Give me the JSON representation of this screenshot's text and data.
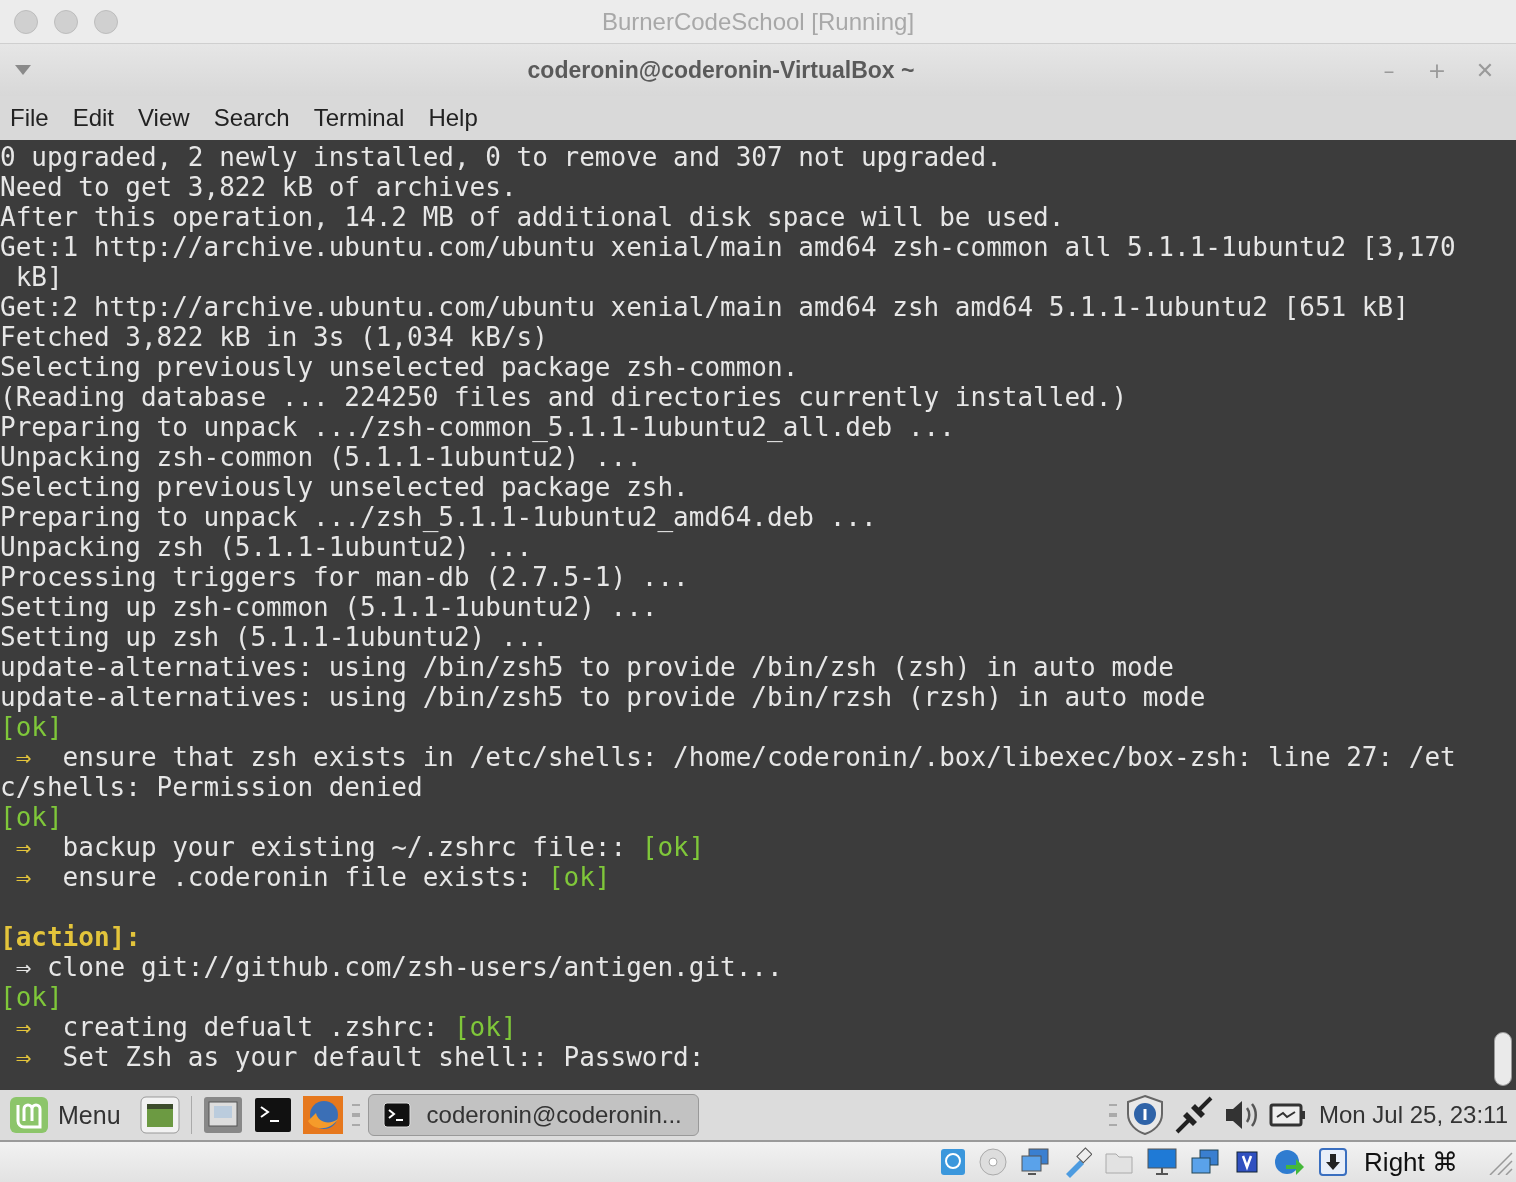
{
  "host_window": {
    "title": "BurnerCodeSchool [Running]"
  },
  "terminal_window": {
    "title": "coderonin@coderonin-VirtualBox ~",
    "window_buttons": [
      "–",
      "+",
      "✕"
    ]
  },
  "menu": [
    "File",
    "Edit",
    "View",
    "Search",
    "Terminal",
    "Help"
  ],
  "terminal_lines": [
    {
      "parts": [
        {
          "kind": "text",
          "text": "0 upgraded, 2 newly installed, 0 to remove and 307 not upgraded."
        }
      ]
    },
    {
      "parts": [
        {
          "kind": "text",
          "text": "Need to get 3,822 kB of archives."
        }
      ]
    },
    {
      "parts": [
        {
          "kind": "text",
          "text": "After this operation, 14.2 MB of additional disk space will be used."
        }
      ]
    },
    {
      "parts": [
        {
          "kind": "text",
          "text": "Get:1 http://archive.ubuntu.com/ubuntu xenial/main amd64 zsh-common all 5.1.1-1ubuntu2 [3,170"
        }
      ]
    },
    {
      "parts": [
        {
          "kind": "text",
          "text": " kB]"
        }
      ]
    },
    {
      "parts": [
        {
          "kind": "text",
          "text": "Get:2 http://archive.ubuntu.com/ubuntu xenial/main amd64 zsh amd64 5.1.1-1ubuntu2 [651 kB]"
        }
      ]
    },
    {
      "parts": [
        {
          "kind": "text",
          "text": "Fetched 3,822 kB in 3s (1,034 kB/s)"
        }
      ]
    },
    {
      "parts": [
        {
          "kind": "text",
          "text": "Selecting previously unselected package zsh-common."
        }
      ]
    },
    {
      "parts": [
        {
          "kind": "text",
          "text": "(Reading database ... 224250 files and directories currently installed.)"
        }
      ]
    },
    {
      "parts": [
        {
          "kind": "text",
          "text": "Preparing to unpack .../zsh-common_5.1.1-1ubuntu2_all.deb ..."
        }
      ]
    },
    {
      "parts": [
        {
          "kind": "text",
          "text": "Unpacking zsh-common (5.1.1-1ubuntu2) ..."
        }
      ]
    },
    {
      "parts": [
        {
          "kind": "text",
          "text": "Selecting previously unselected package zsh."
        }
      ]
    },
    {
      "parts": [
        {
          "kind": "text",
          "text": "Preparing to unpack .../zsh_5.1.1-1ubuntu2_amd64.deb ..."
        }
      ]
    },
    {
      "parts": [
        {
          "kind": "text",
          "text": "Unpacking zsh (5.1.1-1ubuntu2) ..."
        }
      ]
    },
    {
      "parts": [
        {
          "kind": "text",
          "text": "Processing triggers for man-db (2.7.5-1) ..."
        }
      ]
    },
    {
      "parts": [
        {
          "kind": "text",
          "text": "Setting up zsh-common (5.1.1-1ubuntu2) ..."
        }
      ]
    },
    {
      "parts": [
        {
          "kind": "text",
          "text": "Setting up zsh (5.1.1-1ubuntu2) ..."
        }
      ]
    },
    {
      "parts": [
        {
          "kind": "text",
          "text": "update-alternatives: using /bin/zsh5 to provide /bin/zsh (zsh) in auto mode"
        }
      ]
    },
    {
      "parts": [
        {
          "kind": "text",
          "text": "update-alternatives: using /bin/zsh5 to provide /bin/rzsh (rzsh) in auto mode"
        }
      ]
    },
    {
      "parts": [
        {
          "kind": "ok",
          "text": "[ok]"
        }
      ]
    },
    {
      "parts": [
        {
          "kind": "arrow",
          "text": " ⇒ "
        },
        {
          "kind": "text",
          "text": " ensure that zsh exists in /etc/shells: /home/coderonin/.box/libexec/box-zsh: line 27: /et"
        }
      ]
    },
    {
      "parts": [
        {
          "kind": "text",
          "text": "c/shells: Permission denied"
        }
      ]
    },
    {
      "parts": [
        {
          "kind": "ok",
          "text": "[ok]"
        }
      ]
    },
    {
      "parts": [
        {
          "kind": "arrow",
          "text": " ⇒ "
        },
        {
          "kind": "text",
          "text": " backup your existing ~/.zshrc file:: "
        },
        {
          "kind": "ok",
          "text": "[ok]"
        }
      ]
    },
    {
      "parts": [
        {
          "kind": "arrow",
          "text": " ⇒ "
        },
        {
          "kind": "text",
          "text": " ensure .coderonin file exists: "
        },
        {
          "kind": "ok",
          "text": "[ok]"
        }
      ]
    },
    {
      "gap_before": true,
      "parts": [
        {
          "kind": "action",
          "text": "[action]:"
        }
      ]
    },
    {
      "parts": [
        {
          "kind": "text",
          "text": " ⇒ clone git://github.com/zsh-users/antigen.git..."
        }
      ]
    },
    {
      "parts": [
        {
          "kind": "ok",
          "text": "[ok]"
        }
      ]
    },
    {
      "parts": [
        {
          "kind": "arrow",
          "text": " ⇒ "
        },
        {
          "kind": "text",
          "text": " creating defualt .zshrc: "
        },
        {
          "kind": "ok",
          "text": "[ok]"
        }
      ]
    },
    {
      "parts": [
        {
          "kind": "arrow",
          "text": " ⇒ "
        },
        {
          "kind": "text",
          "text": " Set Zsh as your default shell:: Password:"
        }
      ]
    }
  ],
  "taskbar": {
    "menu_label": "Menu",
    "task_label": "coderonin@coderonin...",
    "clock": "Mon Jul 25, 23:11"
  },
  "vbox_status": {
    "host_key": "Right ⌘"
  }
}
